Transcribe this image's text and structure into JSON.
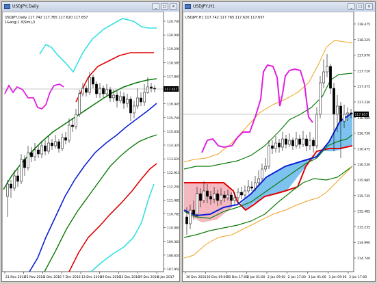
{
  "left": {
    "title": "USDJPY,Daily",
    "ohlc": "USDJPY,Daily  117.742 117.765 117.620 117.657",
    "indicator": "1&ang;1.3(Sim),3",
    "current_price": "117.657",
    "yticks": [
      "120.700",
      "120.000",
      "119.290",
      "118.585",
      "117.865",
      "117.160",
      "116.445",
      "115.740",
      "115.030",
      "114.320",
      "113.620",
      "112.910",
      "112.200",
      "111.485",
      "110.785",
      "110.065",
      "109.360",
      "108.650",
      "107.950"
    ],
    "xticks": [
      "21 Nov 2016",
      "25 Nov 2016",
      "1 Dec 2016",
      "7 Dec 2016",
      "13 Dec 2016",
      "19 Dec 2016",
      "23 Dec 2016",
      "29 Dec 2016",
      "4 Jan 2017"
    ]
  },
  "right": {
    "title": "USDJPY,H1",
    "ohlc": "USDJPY,H1  117.742 117.765 117.620 117.657",
    "current_price": "117.657",
    "yticks": [
      "118.475",
      "118.225",
      "117.970",
      "117.720",
      "117.475",
      "117.230",
      "116.980",
      "116.730",
      "116.475",
      "116.230",
      "115.985",
      "115.735",
      "115.485",
      "115.235",
      "114.990",
      "114.740"
    ],
    "xticks": [
      "30 Dec 2016",
      "30 Dec 09:00",
      "30 Dec 17:00",
      "2 Jan 01:00",
      "2 Jan 09:00",
      "2 Jan 17:00",
      "3 Jan 01:00",
      "3 Jan 09:00",
      "3 Jan 17:00"
    ]
  },
  "colors": {
    "window_bg": "#d4d0c8",
    "cyan_band": "#33e0e0",
    "red_band": "#e00000",
    "green_band": "#0a7a0a",
    "blue_band": "#0a1fd6",
    "magenta_line": "#e01ee0",
    "orange_band": "#f0a020",
    "cloud_blue": "#7ec2f0",
    "cloud_pink": "#f4b8c0"
  },
  "buttons": {
    "minimize": "_",
    "maximize": "□",
    "close": "×"
  }
}
